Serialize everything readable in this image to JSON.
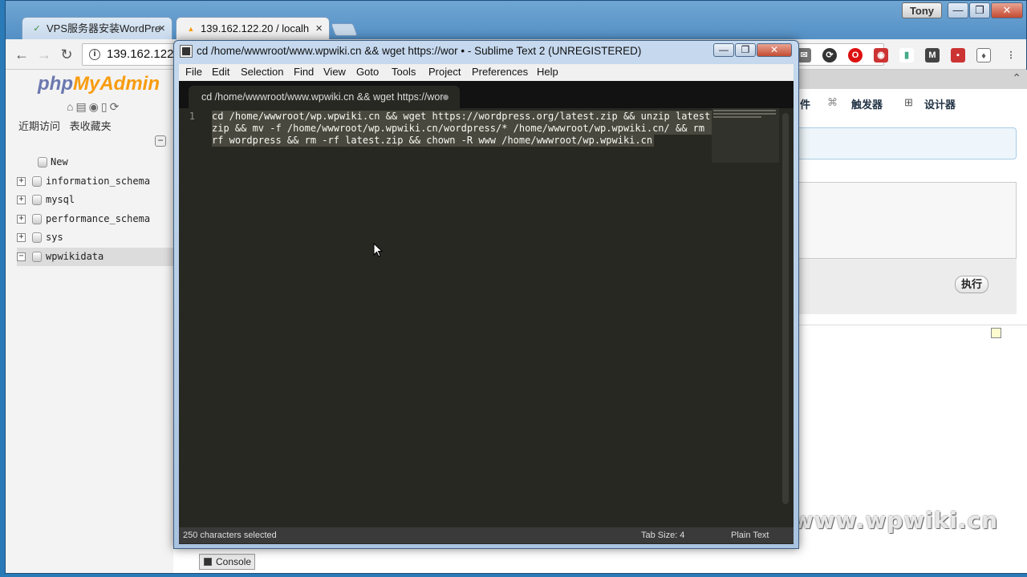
{
  "browser": {
    "tabs": [
      {
        "title": "VPS服务器安装WordPre",
        "favicon": "wordpress-favicon"
      },
      {
        "title": "139.162.122.20 / localh",
        "favicon": "phpmyadmin-favicon"
      }
    ],
    "user_label": "Tony",
    "window_controls": [
      "—",
      "❐",
      "✕"
    ],
    "address": "139.162.122."
  },
  "pma": {
    "logo_php": "php",
    "logo_admin": "MyAdmin",
    "links": [
      "近期访问",
      "表收藏夹"
    ],
    "tree": [
      {
        "label": "New",
        "toggle": ""
      },
      {
        "label": "information_schema",
        "toggle": "+"
      },
      {
        "label": "mysql",
        "toggle": "+"
      },
      {
        "label": "performance_schema",
        "toggle": "+"
      },
      {
        "label": "sys",
        "toggle": "+"
      },
      {
        "label": "wpwikidata",
        "toggle": "−"
      }
    ],
    "tabs": [
      "件",
      "触发器",
      "设计器"
    ],
    "exec_button": "执行",
    "console": "Console"
  },
  "sublime": {
    "title": "cd /home/wwwroot/www.wpwiki.cn && wget https://wor • - Sublime Text 2 (UNREGISTERED)",
    "menu": [
      "File",
      "Edit",
      "Selection",
      "Find",
      "View",
      "Goto",
      "Tools",
      "Project",
      "Preferences",
      "Help"
    ],
    "tab_title": "cd /home/wwwroot/www.wpwiki.cn && wget https://wor",
    "line_number": "1",
    "code_lines": [
      "cd /home/wwwroot/wp.wpwiki.cn && wget https://wordpress.org/latest.zip && unzip latest.",
      "zip && mv -f /home/wwwroot/wp.wpwiki.cn/wordpress/* /home/wwwroot/wp.wpwiki.cn/ && rm -",
      "rf wordpress && rm -rf latest.zip && chown -R www /home/wwwroot/wp.wpwiki.cn"
    ],
    "status_left": "250 characters selected",
    "status_tab": "Tab Size: 4",
    "status_syntax": "Plain Text"
  },
  "watermark": "www.wpwiki.cn",
  "colors": {
    "editor_bg": "#272822",
    "selection": "#49483e",
    "pma_orange": "#f89c0e"
  }
}
